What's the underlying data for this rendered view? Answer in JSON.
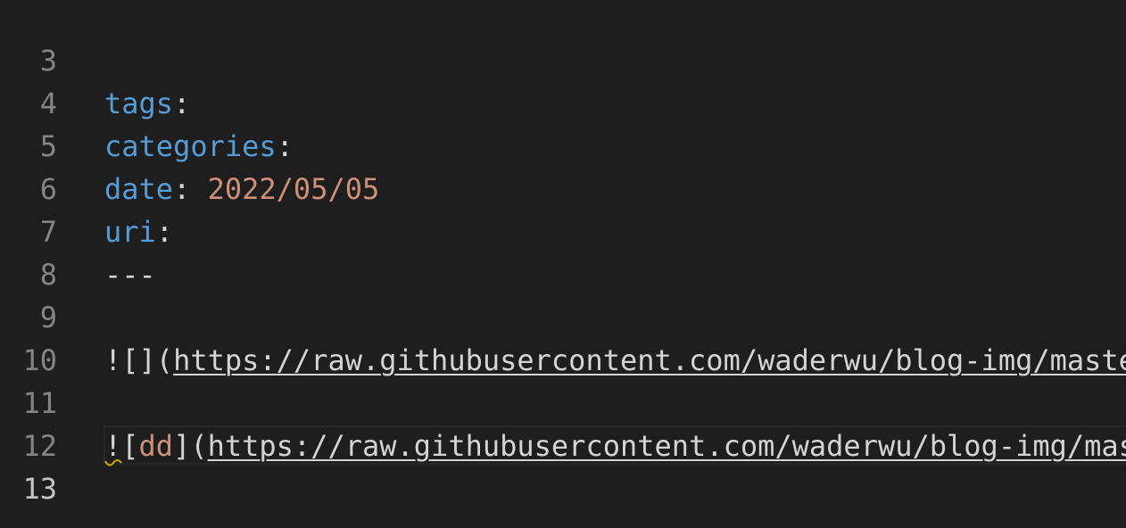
{
  "editor": {
    "lines": [
      {
        "num": "3",
        "key": "tags",
        "sep": ":"
      },
      {
        "num": "4",
        "key": "categories",
        "sep": ":"
      },
      {
        "num": "5",
        "key": "date",
        "sep": ": ",
        "value": "2022/05/05"
      },
      {
        "num": "6",
        "key": "uri",
        "sep": ":"
      },
      {
        "num": "7",
        "text": "---"
      },
      {
        "num": "8"
      },
      {
        "num": "9",
        "prefix": "![](",
        "url": "https://raw.githubusercontent.com/waderwu/blog-img/maste"
      },
      {
        "num": "10"
      },
      {
        "num": "11",
        "prefix_a": "![",
        "alt": "dd",
        "prefix_b": "](",
        "url": "https://raw.githubusercontent.com/waderwu/blog-img/mas"
      },
      {
        "num": "12"
      },
      {
        "num": "13"
      }
    ],
    "active_line": "13",
    "colors": {
      "background": "#1e1e1e",
      "key": "#569cd6",
      "string": "#ce9178",
      "text": "#d4d4d4",
      "line_number": "#858585",
      "warning_squiggle": "#cca700"
    }
  }
}
